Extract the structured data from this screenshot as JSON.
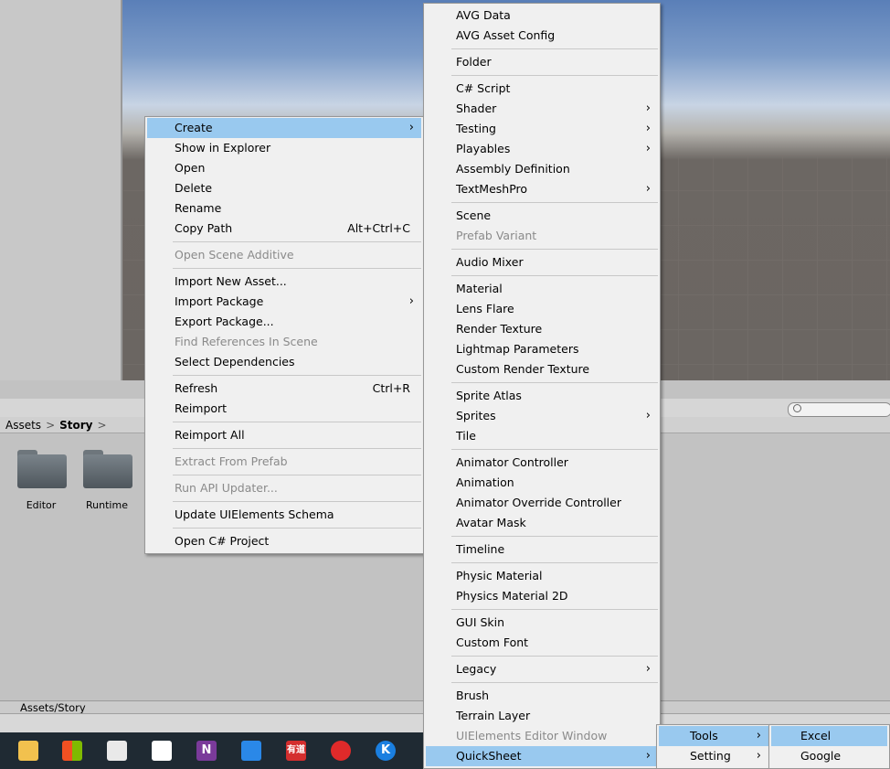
{
  "project": {
    "breadcrumb": [
      "Assets",
      "Story"
    ],
    "folders": [
      "Editor",
      "Runtime"
    ],
    "status_path": "Assets/Story"
  },
  "context_menu": {
    "items": [
      {
        "label": "Create",
        "submenu": true,
        "highlight": true
      },
      {
        "label": "Show in Explorer"
      },
      {
        "label": "Open"
      },
      {
        "label": "Delete"
      },
      {
        "label": "Rename"
      },
      {
        "label": "Copy Path",
        "shortcut": "Alt+Ctrl+C"
      },
      {
        "label": "Open Scene Additive",
        "disabled": true
      },
      {
        "label": "Import New Asset..."
      },
      {
        "label": "Import Package",
        "submenu": true
      },
      {
        "label": "Export Package..."
      },
      {
        "label": "Find References In Scene",
        "disabled": true
      },
      {
        "label": "Select Dependencies"
      },
      {
        "label": "Refresh",
        "shortcut": "Ctrl+R"
      },
      {
        "label": "Reimport"
      },
      {
        "label": "Reimport All"
      },
      {
        "label": "Extract From Prefab",
        "disabled": true
      },
      {
        "label": "Run API Updater...",
        "disabled": true
      },
      {
        "label": "Update UIElements Schema"
      },
      {
        "label": "Open C# Project"
      }
    ]
  },
  "create_menu": {
    "items": [
      {
        "label": "AVG Data"
      },
      {
        "label": "AVG Asset Config"
      },
      {
        "label": "Folder"
      },
      {
        "label": "C# Script"
      },
      {
        "label": "Shader",
        "submenu": true
      },
      {
        "label": "Testing",
        "submenu": true
      },
      {
        "label": "Playables",
        "submenu": true
      },
      {
        "label": "Assembly Definition"
      },
      {
        "label": "TextMeshPro",
        "submenu": true
      },
      {
        "label": "Scene"
      },
      {
        "label": "Prefab Variant",
        "disabled": true
      },
      {
        "label": "Audio Mixer"
      },
      {
        "label": "Material"
      },
      {
        "label": "Lens Flare"
      },
      {
        "label": "Render Texture"
      },
      {
        "label": "Lightmap Parameters"
      },
      {
        "label": "Custom Render Texture"
      },
      {
        "label": "Sprite Atlas"
      },
      {
        "label": "Sprites",
        "submenu": true
      },
      {
        "label": "Tile"
      },
      {
        "label": "Animator Controller"
      },
      {
        "label": "Animation"
      },
      {
        "label": "Animator Override Controller"
      },
      {
        "label": "Avatar Mask"
      },
      {
        "label": "Timeline"
      },
      {
        "label": "Physic Material"
      },
      {
        "label": "Physics Material 2D"
      },
      {
        "label": "GUI Skin"
      },
      {
        "label": "Custom Font"
      },
      {
        "label": "Legacy",
        "submenu": true
      },
      {
        "label": "Brush"
      },
      {
        "label": "Terrain Layer"
      },
      {
        "label": "UIElements Editor Window",
        "disabled": true
      },
      {
        "label": "QuickSheet",
        "submenu": true,
        "highlight": true
      }
    ]
  },
  "quicksheet_menu": {
    "items": [
      {
        "label": "Tools",
        "submenu": true,
        "highlight": true
      },
      {
        "label": "Setting",
        "submenu": true
      }
    ]
  },
  "tools_menu": {
    "items": [
      {
        "label": "Excel",
        "highlight": true
      },
      {
        "label": "Google"
      }
    ]
  },
  "taskbar": {
    "icons": [
      "file-explorer-icon",
      "store-icon",
      "mail-icon",
      "photos-icon",
      "onenote-icon",
      "notes-icon",
      "youdao-icon",
      "netease-music-icon",
      "kugou-icon"
    ],
    "onenote_glyph": "N",
    "youdao_glyph": "有道",
    "kugou_glyph": "K"
  },
  "colors": {
    "menu_bg": "#f0f0f0",
    "highlight": "#99c9ef",
    "disabled_text": "#8a8a8a",
    "taskbar": "#1f2a33"
  }
}
